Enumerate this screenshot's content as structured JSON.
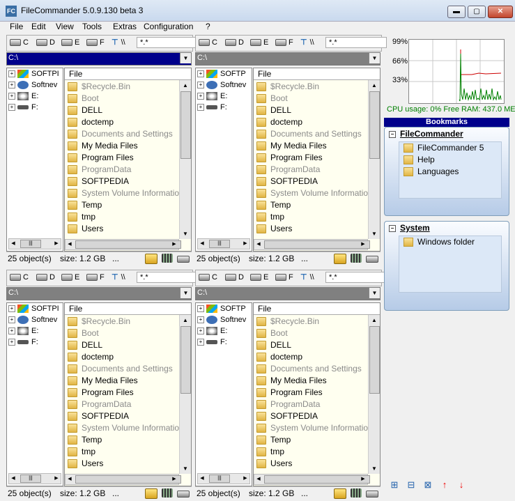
{
  "window": {
    "title": "FileCommander 5.0.9.130 beta 3",
    "icon_text": "FC",
    "min_glyph": "▬",
    "max_glyph": "▢",
    "close_glyph": "✕"
  },
  "menu": [
    "File",
    "Edit",
    "View",
    "Tools",
    "Extras",
    "Configuration",
    "?"
  ],
  "panels": [
    {
      "drives": [
        "C",
        "D",
        "E",
        "F"
      ],
      "root_label": "\\\\",
      "filter": "*.*",
      "path": "C:\\",
      "tree": [
        "SOFTPI",
        "Softnev",
        "E:",
        "F:"
      ],
      "column": "File",
      "files": [
        "$Recycle.Bin",
        "Boot",
        "DELL",
        "doctemp",
        "Documents and Settings",
        "My Media Files",
        "Program Files",
        "ProgramData",
        "SOFTPEDIA",
        "System Volume Information",
        "Temp",
        "tmp",
        "Users"
      ],
      "status": {
        "count": "25 object(s)",
        "size": "size: 1.2 GB",
        "more": "..."
      }
    },
    {
      "drives": [
        "C",
        "D",
        "E",
        "F"
      ],
      "root_label": "\\\\",
      "filter": "*.*",
      "path": "C:\\",
      "tree": [
        "SOFTP",
        "Softnev",
        "E:",
        "F:"
      ],
      "column": "File",
      "files": [
        "$Recycle.Bin",
        "Boot",
        "DELL",
        "doctemp",
        "Documents and Settings",
        "My Media Files",
        "Program Files",
        "ProgramData",
        "SOFTPEDIA",
        "System Volume Information",
        "Temp",
        "tmp",
        "Users"
      ],
      "status": {
        "count": "25 object(s)",
        "size": "size: 1.2 GB",
        "more": "..."
      }
    },
    {
      "drives": [
        "C",
        "D",
        "E",
        "F"
      ],
      "root_label": "\\\\",
      "filter": "*.*",
      "path": "C:\\",
      "tree": [
        "SOFTPI",
        "Softnev",
        "E:",
        "F:"
      ],
      "column": "File",
      "files": [
        "$Recycle.Bin",
        "Boot",
        "DELL",
        "doctemp",
        "Documents and Settings",
        "My Media Files",
        "Program Files",
        "ProgramData",
        "SOFTPEDIA",
        "System Volume Information",
        "Temp",
        "tmp",
        "Users"
      ],
      "status": {
        "count": "25 object(s)",
        "size": "size: 1.2 GB",
        "more": "..."
      }
    },
    {
      "drives": [
        "C",
        "D",
        "E",
        "F"
      ],
      "root_label": "\\\\",
      "filter": "*.*",
      "path": "C:\\",
      "tree": [
        "SOFTP",
        "Softnev",
        "E:",
        "F:"
      ],
      "column": "File",
      "files": [
        "$Recycle.Bin",
        "Boot",
        "DELL",
        "doctemp",
        "Documents and Settings",
        "My Media Files",
        "Program Files",
        "ProgramData",
        "SOFTPEDIA",
        "System Volume Information",
        "Temp",
        "tmp",
        "Users"
      ],
      "status": {
        "count": "25 object(s)",
        "size": "size: 1.2 GB",
        "more": "..."
      }
    }
  ],
  "monitor": {
    "ticks": [
      "99%",
      "66%",
      "33%"
    ],
    "stats": "CPU usage: 0% Free RAM: 437.0 ME",
    "cpu_color": "#008000",
    "ram_color": "#cc0000"
  },
  "bookmarks": {
    "header": "Bookmarks",
    "groups": [
      {
        "title": "FileCommander",
        "items": [
          "FileCommander 5",
          "Help",
          "Languages"
        ]
      },
      {
        "title": "System",
        "items": [
          "Windows folder"
        ]
      }
    ]
  },
  "colors": {
    "path_active": "#00008b",
    "path_inactive": "#808080",
    "list_bg": "#fffff0",
    "dim_text": "#8a8a8a"
  },
  "icons": {
    "add_bookmark": "add-bookmark-icon",
    "add_group": "add-group-icon",
    "delete_bookmark": "delete-bookmark-icon",
    "move_up": "arrow-up-icon",
    "move_down": "arrow-down-icon"
  }
}
